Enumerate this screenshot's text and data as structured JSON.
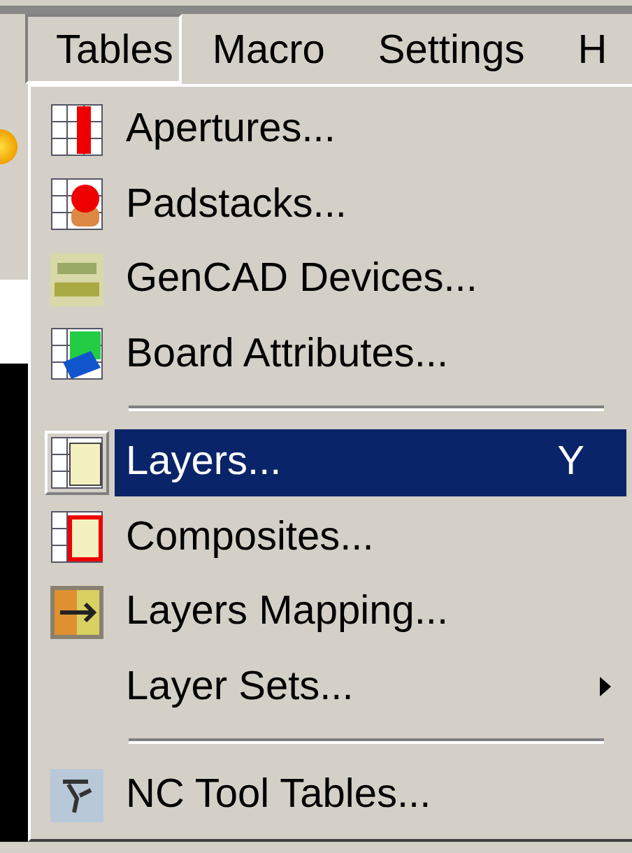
{
  "menu_bar": [
    {
      "label": "Tables",
      "selected": true
    },
    {
      "label": "Macro",
      "selected": false
    },
    {
      "label": "Settings",
      "selected": false
    },
    {
      "label": "H",
      "selected": false
    }
  ],
  "menu": {
    "items": [
      {
        "kind": "item",
        "label": "Apertures...",
        "selected": false,
        "has_icon": true
      },
      {
        "kind": "item",
        "label": "Padstacks...",
        "selected": false,
        "has_icon": true
      },
      {
        "kind": "item",
        "label": "GenCAD Devices...",
        "selected": false,
        "has_icon": true
      },
      {
        "kind": "item",
        "label": "Board Attributes...",
        "selected": false,
        "has_icon": true
      },
      {
        "kind": "separator"
      },
      {
        "kind": "item",
        "label": "Layers...",
        "shortcut": "Y",
        "selected": true,
        "has_icon": true
      },
      {
        "kind": "item",
        "label": "Composites...",
        "selected": false,
        "has_icon": true
      },
      {
        "kind": "item",
        "label": "Layers Mapping...",
        "selected": false,
        "has_icon": true
      },
      {
        "kind": "item",
        "label": "Layer Sets...",
        "selected": false,
        "has_icon": false,
        "has_submenu": true
      },
      {
        "kind": "separator"
      },
      {
        "kind": "item",
        "label": "NC Tool Tables...",
        "selected": false,
        "has_icon": true
      }
    ]
  }
}
